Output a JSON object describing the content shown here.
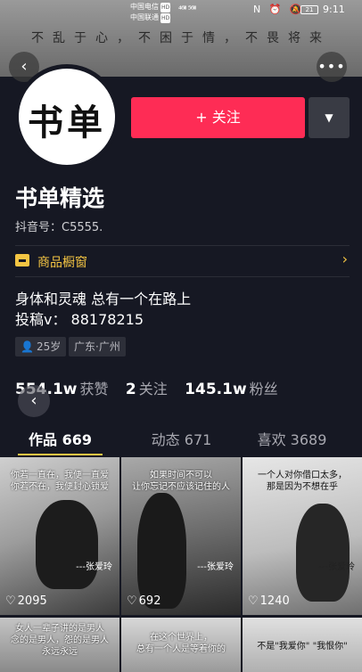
{
  "status_bar": {
    "carrier1": "中国电信",
    "carrier2": "中国联通",
    "hd": "HD",
    "signal": "⁴⁶ᴵᴵᴵ ⁵⁶ᴵᴵᴵ",
    "icons": "N ⏰ 🔕",
    "battery": "21",
    "time": "9:11"
  },
  "cover": {
    "text": "不乱于心，不困于情，不畏将来"
  },
  "nav": {
    "back": "‹",
    "more": "•••"
  },
  "profile": {
    "avatar_text": "书单",
    "follow_label": "+ 关注",
    "dropdown_label": "▼",
    "name": "书单精选",
    "douyin_id": "抖音号：C5555.",
    "shop_label": "商品橱窗",
    "shop_chevron": "›",
    "bio_line1": "身体和灵魂 总有一个在路上",
    "bio_line2": "投稿v：  88178215",
    "tag_age": "25岁",
    "tag_age_icon": "👤",
    "tag_location": "广东·广州"
  },
  "stats": {
    "likes_value": "554.1w",
    "likes_label": "获赞",
    "following_value": "2",
    "following_label": "关注",
    "followers_value": "145.1w",
    "followers_label": "粉丝"
  },
  "float_back": "‹",
  "tabs": [
    {
      "label": "作品 669"
    },
    {
      "label": "动态 671"
    },
    {
      "label": "喜欢 3689"
    }
  ],
  "accent_color": "#fe2c55",
  "highlight_color": "#f4c543",
  "videos": [
    {
      "caption": "你若一直在，我便一直爱\n你若不在，我便封心锁爱",
      "signature": "---张爱玲",
      "likes": "2095"
    },
    {
      "caption": "如果时间不可以\n让你忘记不应该记住的人",
      "signature": "---张爱玲",
      "likes": "692"
    },
    {
      "caption": "一个人对你借口太多，\n那是因为不想在乎",
      "signature": "---张爱玲",
      "likes": "1240"
    },
    {
      "caption": "女人一辈子讲的是男人\n念的是男人，怨的是男人\n永远永远",
      "signature": "",
      "likes": ""
    },
    {
      "caption": "在这个世界上，\n总有一个人是等着你的",
      "signature": "",
      "likes": ""
    },
    {
      "caption": "不是\"我爱你\" \"我恨你\"",
      "signature": "",
      "likes": ""
    }
  ]
}
